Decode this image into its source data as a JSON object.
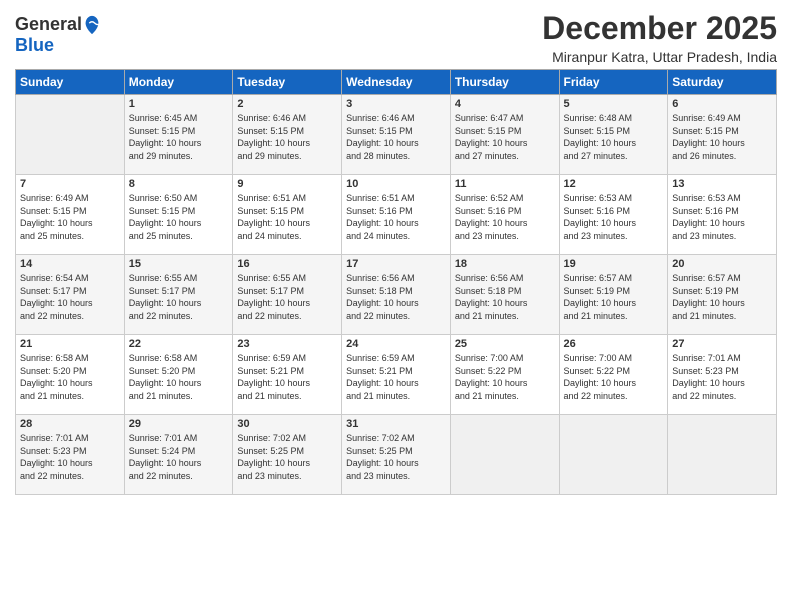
{
  "header": {
    "logo_line1": "General",
    "logo_line2": "Blue",
    "month": "December 2025",
    "location": "Miranpur Katra, Uttar Pradesh, India"
  },
  "weekdays": [
    "Sunday",
    "Monday",
    "Tuesday",
    "Wednesday",
    "Thursday",
    "Friday",
    "Saturday"
  ],
  "weeks": [
    [
      {
        "day": "",
        "info": ""
      },
      {
        "day": "1",
        "info": "Sunrise: 6:45 AM\nSunset: 5:15 PM\nDaylight: 10 hours\nand 29 minutes."
      },
      {
        "day": "2",
        "info": "Sunrise: 6:46 AM\nSunset: 5:15 PM\nDaylight: 10 hours\nand 29 minutes."
      },
      {
        "day": "3",
        "info": "Sunrise: 6:46 AM\nSunset: 5:15 PM\nDaylight: 10 hours\nand 28 minutes."
      },
      {
        "day": "4",
        "info": "Sunrise: 6:47 AM\nSunset: 5:15 PM\nDaylight: 10 hours\nand 27 minutes."
      },
      {
        "day": "5",
        "info": "Sunrise: 6:48 AM\nSunset: 5:15 PM\nDaylight: 10 hours\nand 27 minutes."
      },
      {
        "day": "6",
        "info": "Sunrise: 6:49 AM\nSunset: 5:15 PM\nDaylight: 10 hours\nand 26 minutes."
      }
    ],
    [
      {
        "day": "7",
        "info": "Sunrise: 6:49 AM\nSunset: 5:15 PM\nDaylight: 10 hours\nand 25 minutes."
      },
      {
        "day": "8",
        "info": "Sunrise: 6:50 AM\nSunset: 5:15 PM\nDaylight: 10 hours\nand 25 minutes."
      },
      {
        "day": "9",
        "info": "Sunrise: 6:51 AM\nSunset: 5:15 PM\nDaylight: 10 hours\nand 24 minutes."
      },
      {
        "day": "10",
        "info": "Sunrise: 6:51 AM\nSunset: 5:16 PM\nDaylight: 10 hours\nand 24 minutes."
      },
      {
        "day": "11",
        "info": "Sunrise: 6:52 AM\nSunset: 5:16 PM\nDaylight: 10 hours\nand 23 minutes."
      },
      {
        "day": "12",
        "info": "Sunrise: 6:53 AM\nSunset: 5:16 PM\nDaylight: 10 hours\nand 23 minutes."
      },
      {
        "day": "13",
        "info": "Sunrise: 6:53 AM\nSunset: 5:16 PM\nDaylight: 10 hours\nand 23 minutes."
      }
    ],
    [
      {
        "day": "14",
        "info": "Sunrise: 6:54 AM\nSunset: 5:17 PM\nDaylight: 10 hours\nand 22 minutes."
      },
      {
        "day": "15",
        "info": "Sunrise: 6:55 AM\nSunset: 5:17 PM\nDaylight: 10 hours\nand 22 minutes."
      },
      {
        "day": "16",
        "info": "Sunrise: 6:55 AM\nSunset: 5:17 PM\nDaylight: 10 hours\nand 22 minutes."
      },
      {
        "day": "17",
        "info": "Sunrise: 6:56 AM\nSunset: 5:18 PM\nDaylight: 10 hours\nand 22 minutes."
      },
      {
        "day": "18",
        "info": "Sunrise: 6:56 AM\nSunset: 5:18 PM\nDaylight: 10 hours\nand 21 minutes."
      },
      {
        "day": "19",
        "info": "Sunrise: 6:57 AM\nSunset: 5:19 PM\nDaylight: 10 hours\nand 21 minutes."
      },
      {
        "day": "20",
        "info": "Sunrise: 6:57 AM\nSunset: 5:19 PM\nDaylight: 10 hours\nand 21 minutes."
      }
    ],
    [
      {
        "day": "21",
        "info": "Sunrise: 6:58 AM\nSunset: 5:20 PM\nDaylight: 10 hours\nand 21 minutes."
      },
      {
        "day": "22",
        "info": "Sunrise: 6:58 AM\nSunset: 5:20 PM\nDaylight: 10 hours\nand 21 minutes."
      },
      {
        "day": "23",
        "info": "Sunrise: 6:59 AM\nSunset: 5:21 PM\nDaylight: 10 hours\nand 21 minutes."
      },
      {
        "day": "24",
        "info": "Sunrise: 6:59 AM\nSunset: 5:21 PM\nDaylight: 10 hours\nand 21 minutes."
      },
      {
        "day": "25",
        "info": "Sunrise: 7:00 AM\nSunset: 5:22 PM\nDaylight: 10 hours\nand 21 minutes."
      },
      {
        "day": "26",
        "info": "Sunrise: 7:00 AM\nSunset: 5:22 PM\nDaylight: 10 hours\nand 22 minutes."
      },
      {
        "day": "27",
        "info": "Sunrise: 7:01 AM\nSunset: 5:23 PM\nDaylight: 10 hours\nand 22 minutes."
      }
    ],
    [
      {
        "day": "28",
        "info": "Sunrise: 7:01 AM\nSunset: 5:23 PM\nDaylight: 10 hours\nand 22 minutes."
      },
      {
        "day": "29",
        "info": "Sunrise: 7:01 AM\nSunset: 5:24 PM\nDaylight: 10 hours\nand 22 minutes."
      },
      {
        "day": "30",
        "info": "Sunrise: 7:02 AM\nSunset: 5:25 PM\nDaylight: 10 hours\nand 23 minutes."
      },
      {
        "day": "31",
        "info": "Sunrise: 7:02 AM\nSunset: 5:25 PM\nDaylight: 10 hours\nand 23 minutes."
      },
      {
        "day": "",
        "info": ""
      },
      {
        "day": "",
        "info": ""
      },
      {
        "day": "",
        "info": ""
      }
    ]
  ]
}
